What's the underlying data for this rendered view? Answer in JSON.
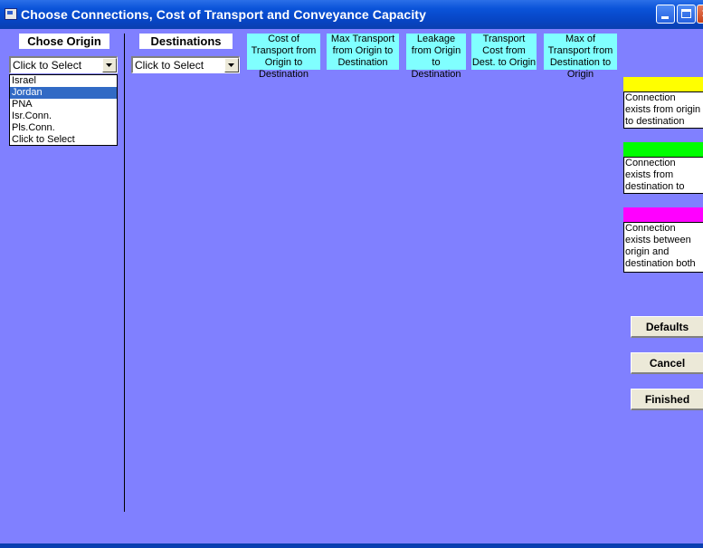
{
  "window": {
    "title": "Choose Connections, Cost of Transport and Conveyance Capacity",
    "controls": {
      "minimize_icon": "minimize-icon",
      "maximize_icon": "maximize-icon",
      "close_icon": "close-icon"
    }
  },
  "origin": {
    "label": "Chose Origin",
    "select_value": "Click to Select",
    "list": [
      {
        "text": "Israel",
        "selected": false
      },
      {
        "text": "Jordan",
        "selected": true
      },
      {
        "text": "PNA",
        "selected": false
      },
      {
        "text": "Isr.Conn.",
        "selected": false
      },
      {
        "text": "Pls.Conn.",
        "selected": false
      },
      {
        "text": "Click to Select",
        "selected": false
      }
    ]
  },
  "destinations": {
    "label": "Destinations",
    "select_value": "Click to Select"
  },
  "columns": [
    "Cost of Transport from Origin to Destination",
    "Max Transport from Origin to Destination",
    "Leakage from Origin to Destination",
    "Transport Cost from Dest. to Origin",
    "Max of Transport from Destination to Origin"
  ],
  "legend": [
    {
      "color": "#ffff00",
      "text": "Connection exists from origin to destination"
    },
    {
      "color": "#00ff00",
      "text": "Connection exists from destination to origin"
    },
    {
      "color": "#ff00ff",
      "text": "Connection exists between origin and destination both ways"
    }
  ],
  "buttons": {
    "defaults": "Defaults",
    "cancel": "Cancel",
    "finished": "Finished"
  },
  "colors": {
    "background": "#8080ff",
    "header_cells": "#80ffff",
    "list_selection": "#316ac5"
  }
}
